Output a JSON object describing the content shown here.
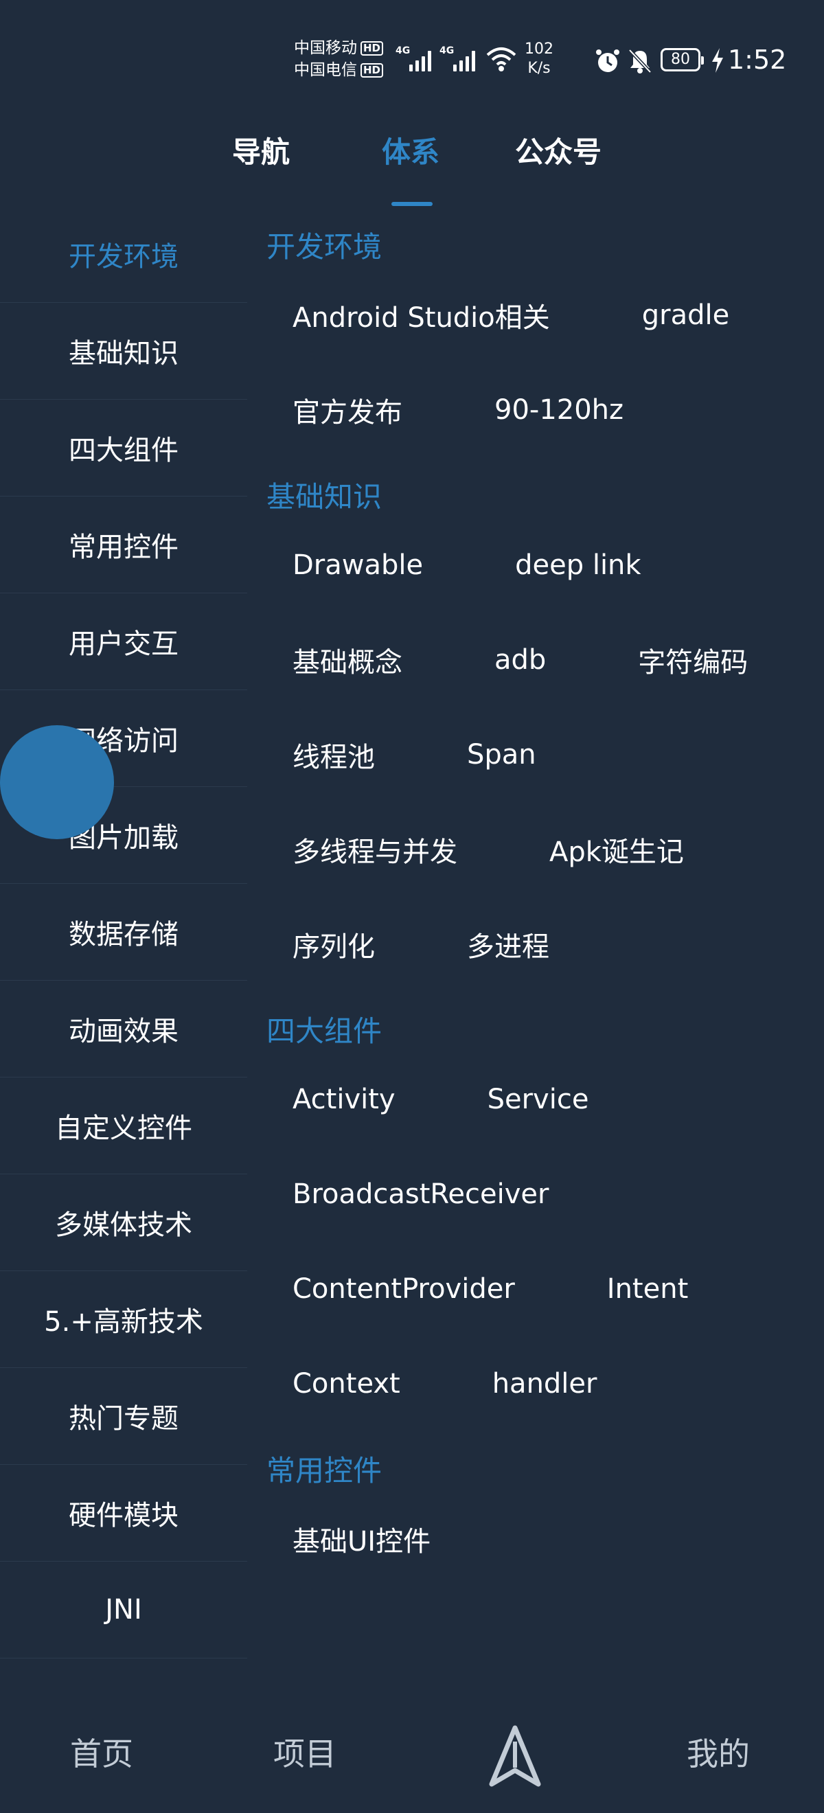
{
  "status_bar": {
    "carrier_1": "中国移动",
    "carrier_2": "中国电信",
    "hd": "HD",
    "network_type": "4G",
    "net_speed_value": "102",
    "net_speed_unit": "K/s",
    "battery": "80",
    "time": "1:52"
  },
  "top_tabs": [
    {
      "label": "导航",
      "active": false
    },
    {
      "label": "体系",
      "active": true
    },
    {
      "label": "公众号",
      "active": false
    }
  ],
  "categories": [
    {
      "label": "开发环境",
      "active": true
    },
    {
      "label": "基础知识"
    },
    {
      "label": "四大组件"
    },
    {
      "label": "常用控件"
    },
    {
      "label": "用户交互"
    },
    {
      "label": "网络访问"
    },
    {
      "label": "图片加载"
    },
    {
      "label": "数据存储"
    },
    {
      "label": "动画效果"
    },
    {
      "label": "自定义控件"
    },
    {
      "label": "多媒体技术"
    },
    {
      "label": "5.+高新技术"
    },
    {
      "label": "热门专题"
    },
    {
      "label": "硬件模块"
    },
    {
      "label": "JNI"
    }
  ],
  "sections": [
    {
      "title": "开发环境",
      "rows": [
        [
          "Android Studio相关",
          "gradle"
        ],
        [
          "官方发布",
          "90-120hz"
        ]
      ]
    },
    {
      "title": "基础知识",
      "rows": [
        [
          "Drawable",
          "deep link"
        ],
        [
          "基础概念",
          "adb",
          "字符编码"
        ],
        [
          "线程池",
          "Span"
        ],
        [
          "多线程与并发",
          "Apk诞生记"
        ],
        [
          "序列化",
          "多进程"
        ]
      ]
    },
    {
      "title": "四大组件",
      "rows": [
        [
          "Activity",
          "Service"
        ],
        [
          "BroadcastReceiver"
        ],
        [
          "ContentProvider",
          "Intent"
        ],
        [
          "Context",
          "handler"
        ]
      ]
    },
    {
      "title": "常用控件",
      "rows": [
        [
          "基础UI控件"
        ]
      ]
    }
  ],
  "bottom_nav": {
    "home": "首页",
    "project": "项目",
    "mine": "我的"
  },
  "colors": {
    "background": "#1f2c3d",
    "accent": "#2f86c7",
    "text": "#ffffff"
  }
}
